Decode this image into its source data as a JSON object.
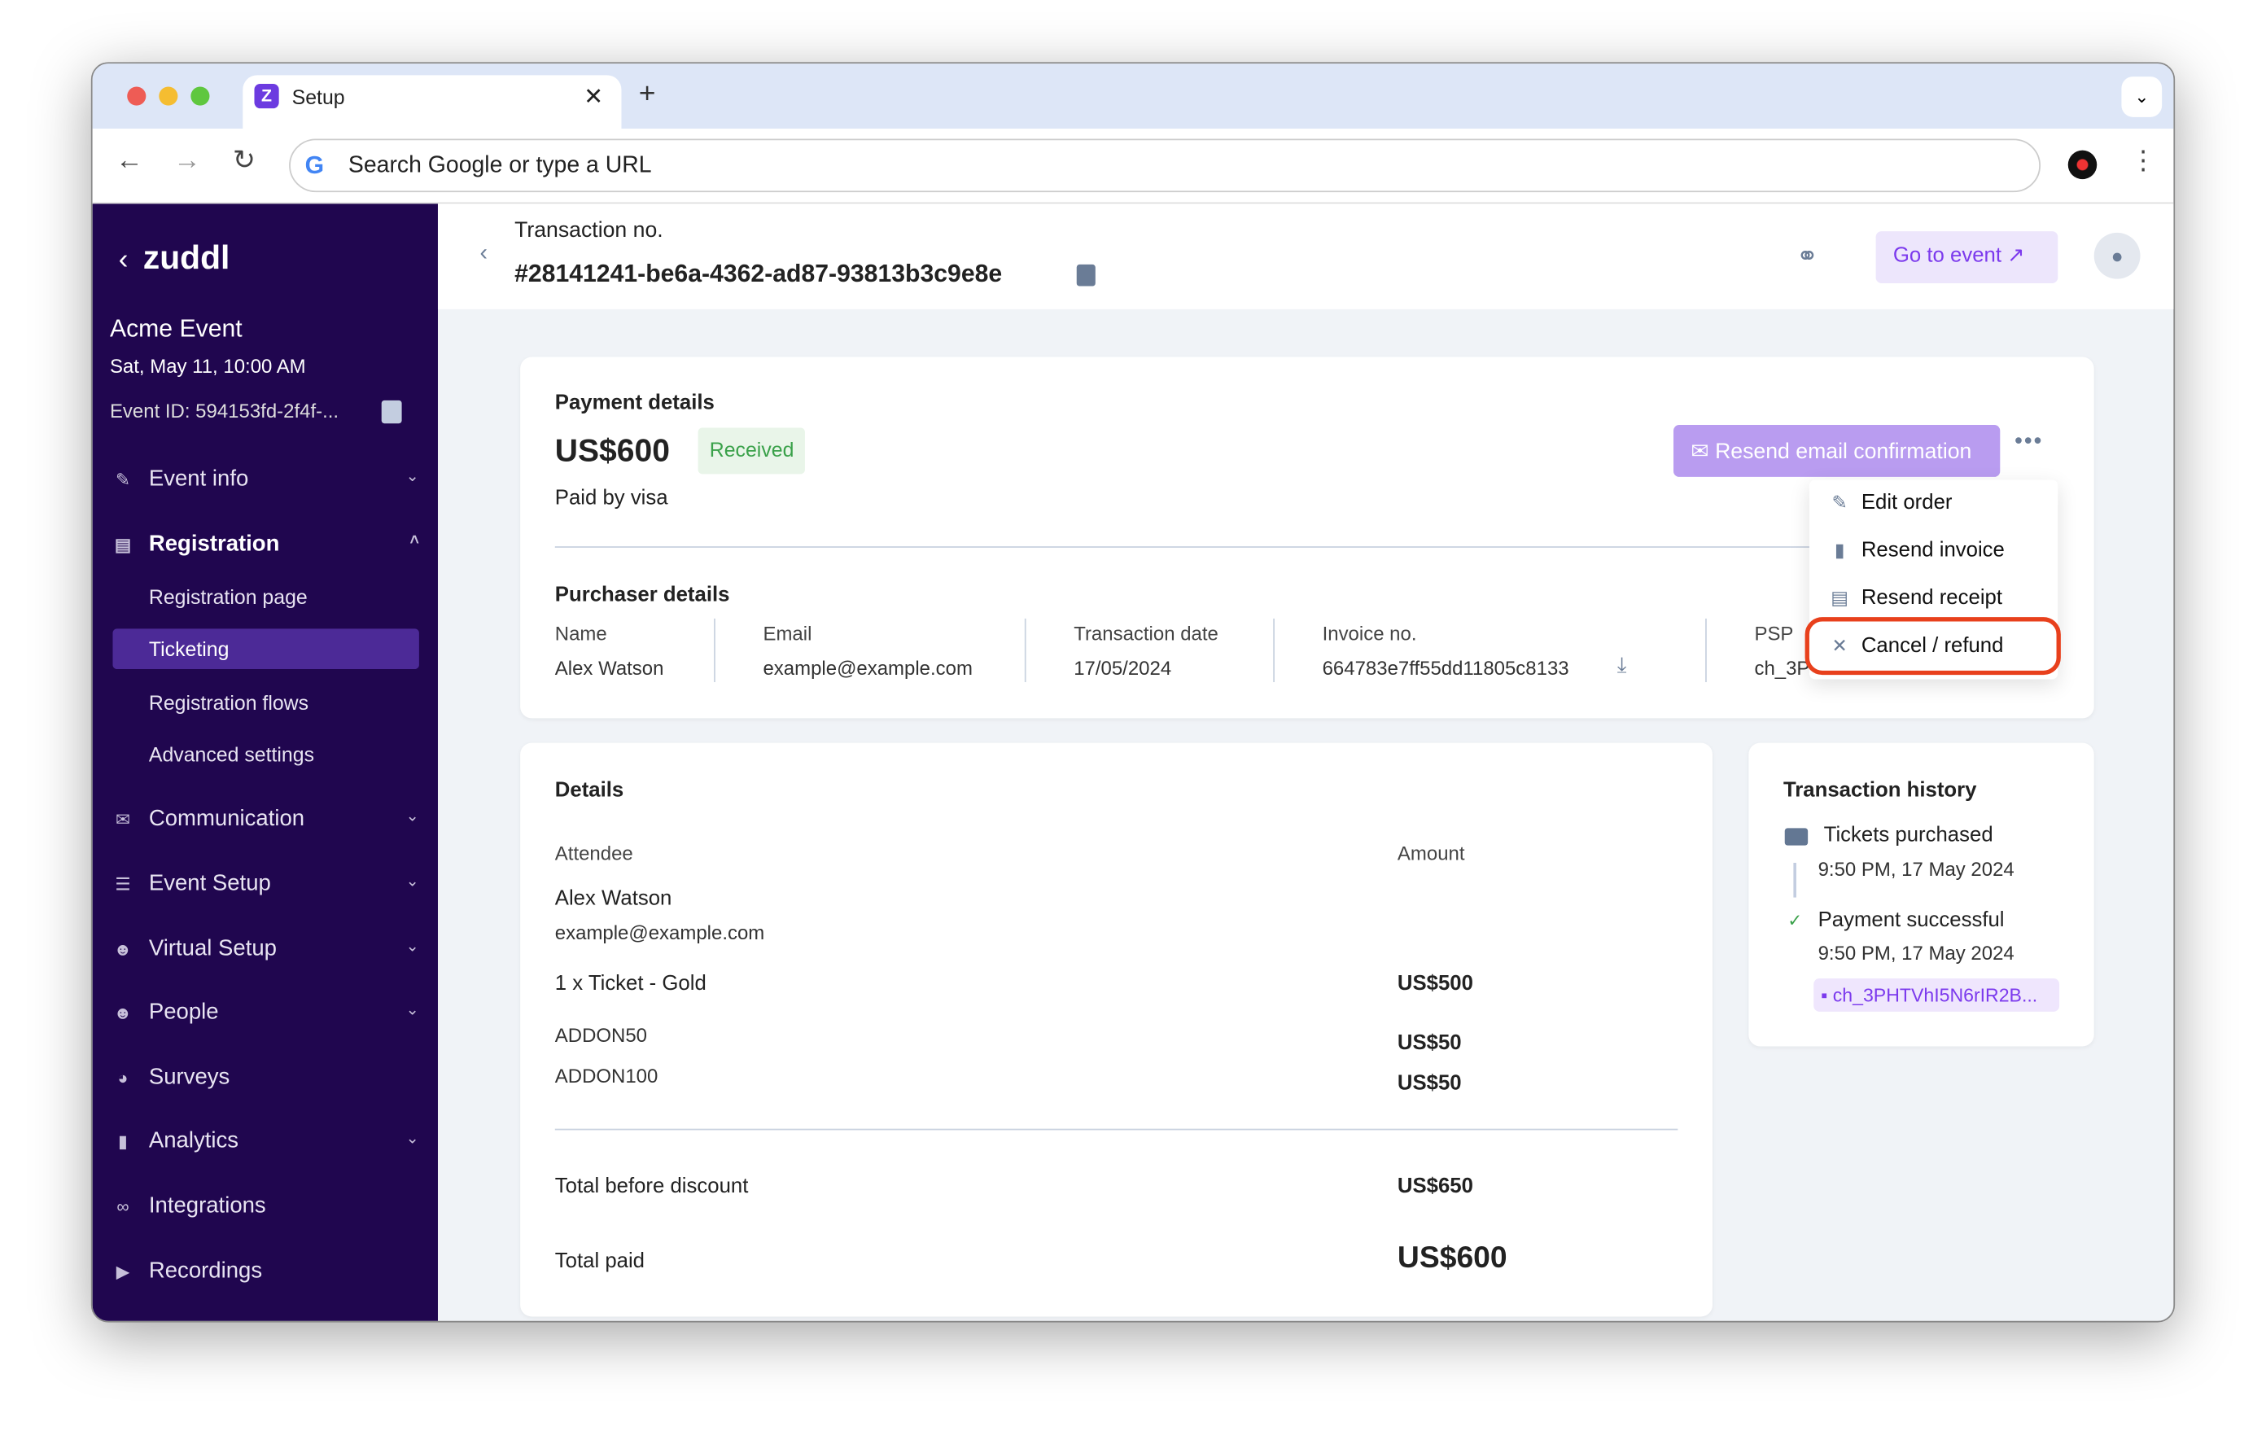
{
  "browser": {
    "tab_title": "Setup",
    "address_placeholder": "Search Google or type a URL"
  },
  "sidebar": {
    "logo": "zuddl",
    "event_name": "Acme Event",
    "event_date": "Sat, May 11, 10:00 AM",
    "event_id": "Event ID: 594153fd-2f4f-...",
    "items": [
      {
        "label": "Event info",
        "icon": "magic-wand-icon"
      },
      {
        "label": "Registration",
        "icon": "form-icon"
      },
      {
        "label": "Communication",
        "icon": "mail-icon"
      },
      {
        "label": "Event Setup",
        "icon": "sliders-icon"
      },
      {
        "label": "Virtual Setup",
        "icon": "users-icon"
      },
      {
        "label": "People",
        "icon": "people-icon"
      },
      {
        "label": "Surveys",
        "icon": "pie-icon"
      },
      {
        "label": "Analytics",
        "icon": "bar-chart-icon"
      },
      {
        "label": "Integrations",
        "icon": "link-icon"
      },
      {
        "label": "Recordings",
        "icon": "play-icon"
      }
    ],
    "registration_sub": [
      "Registration page",
      "Ticketing",
      "Registration flows",
      "Advanced settings"
    ],
    "active_sub": "Ticketing"
  },
  "header": {
    "label": "Transaction no.",
    "transaction_id": "#28141241-be6a-4362-ad87-93813b3c9e8e",
    "go_to_event": "Go to event"
  },
  "payment": {
    "title": "Payment details",
    "amount": "US$600",
    "status": "Received",
    "paid_by": "Paid by visa",
    "resend_button": "Resend email confirmation",
    "menu": [
      "Edit order",
      "Resend invoice",
      "Resend receipt",
      "Cancel / refund"
    ],
    "purchaser_title": "Purchaser details",
    "fields": [
      {
        "label": "Name",
        "value": "Alex Watson"
      },
      {
        "label": "Email",
        "value": "example@example.com"
      },
      {
        "label": "Transaction date",
        "value": "17/05/2024"
      },
      {
        "label": "Invoice no.",
        "value": "664783e7ff55dd11805c8133"
      },
      {
        "label": "PSP",
        "value": "ch_3P"
      }
    ]
  },
  "details": {
    "title": "Details",
    "col_attendee": "Attendee",
    "col_amount": "Amount",
    "attendee_name": "Alex Watson",
    "attendee_email": "example@example.com",
    "lines": [
      {
        "item": "1 x Ticket - Gold",
        "amount": "US$500"
      },
      {
        "item": "ADDON50",
        "amount": "US$50"
      },
      {
        "item": "ADDON100",
        "amount": "US$50"
      }
    ],
    "total_before_label": "Total before discount",
    "total_before": "US$650",
    "total_paid_label": "Total paid",
    "total_paid": "US$600"
  },
  "history": {
    "title": "Transaction history",
    "events": [
      {
        "label": "Tickets purchased",
        "time": "9:50 PM, 17 May 2024"
      },
      {
        "label": "Payment successful",
        "time": "9:50 PM, 17 May 2024"
      }
    ],
    "charge_id": "ch_3PHTVhI5N6rIR2B..."
  },
  "colors": {
    "sidebar": "#20064f",
    "accent": "#7c3aed",
    "highlight": "#e8401c",
    "success": "#3aa14a"
  }
}
